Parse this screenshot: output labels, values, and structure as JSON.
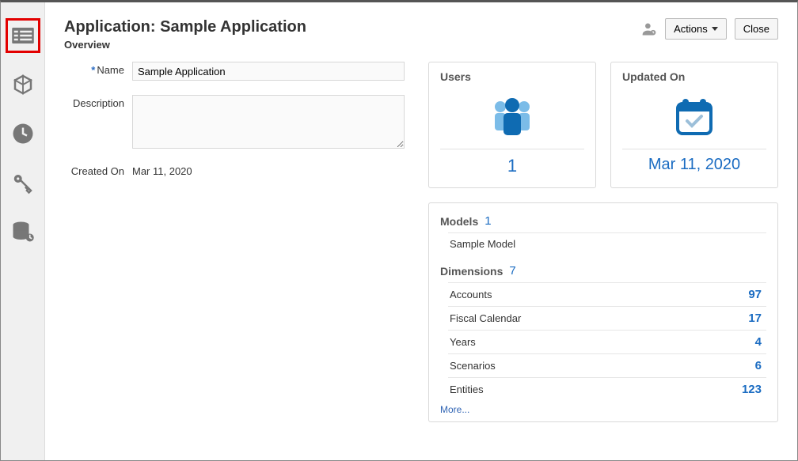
{
  "header": {
    "title": "Application: Sample Application",
    "subtitle": "Overview",
    "actions_label": "Actions",
    "close_label": "Close"
  },
  "form": {
    "name_label": "Name",
    "name_value": "Sample Application",
    "description_label": "Description",
    "description_value": "",
    "created_on_label": "Created On",
    "created_on_value": "Mar 11, 2020"
  },
  "users_card": {
    "title": "Users",
    "value": "1"
  },
  "updated_card": {
    "title": "Updated On",
    "value": "Mar 11, 2020"
  },
  "models": {
    "title": "Models",
    "count": "1",
    "items": [
      {
        "name": "Sample Model"
      }
    ]
  },
  "dimensions": {
    "title": "Dimensions",
    "count": "7",
    "rows": [
      {
        "name": "Accounts",
        "value": "97"
      },
      {
        "name": "Fiscal Calendar",
        "value": "17"
      },
      {
        "name": "Years",
        "value": "4"
      },
      {
        "name": "Scenarios",
        "value": "6"
      },
      {
        "name": "Entities",
        "value": "123"
      }
    ],
    "more_label": "More..."
  },
  "sidebar": {
    "items": [
      {
        "name": "overview"
      },
      {
        "name": "cube"
      },
      {
        "name": "clock"
      },
      {
        "name": "keys"
      },
      {
        "name": "database"
      }
    ]
  }
}
